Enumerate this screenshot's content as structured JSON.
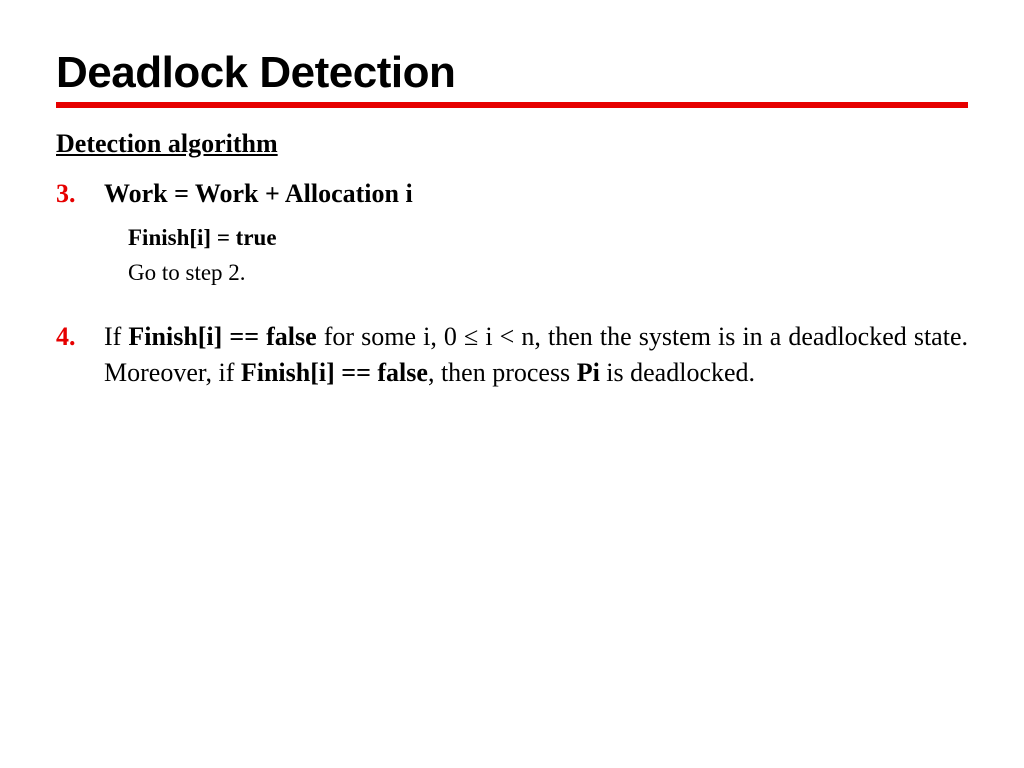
{
  "title": "Deadlock Detection",
  "heading": "Detection algorithm",
  "item3": {
    "num": "3.",
    "headline": "Work = Work + Allocation i",
    "sub_bold": "Finish[i] = true",
    "sub_plain": "Go to step 2."
  },
  "item4": {
    "num": "4.",
    "t1": "If ",
    "t2": "Finish[i] == false",
    "t3": " for some i, 0 ≤ i < n, then the system is in a deadlocked state. Moreover, if ",
    "t4": "Finish[i] == false",
    "t5": ", then process ",
    "t6": "Pi",
    "t7": " is deadlocked."
  }
}
